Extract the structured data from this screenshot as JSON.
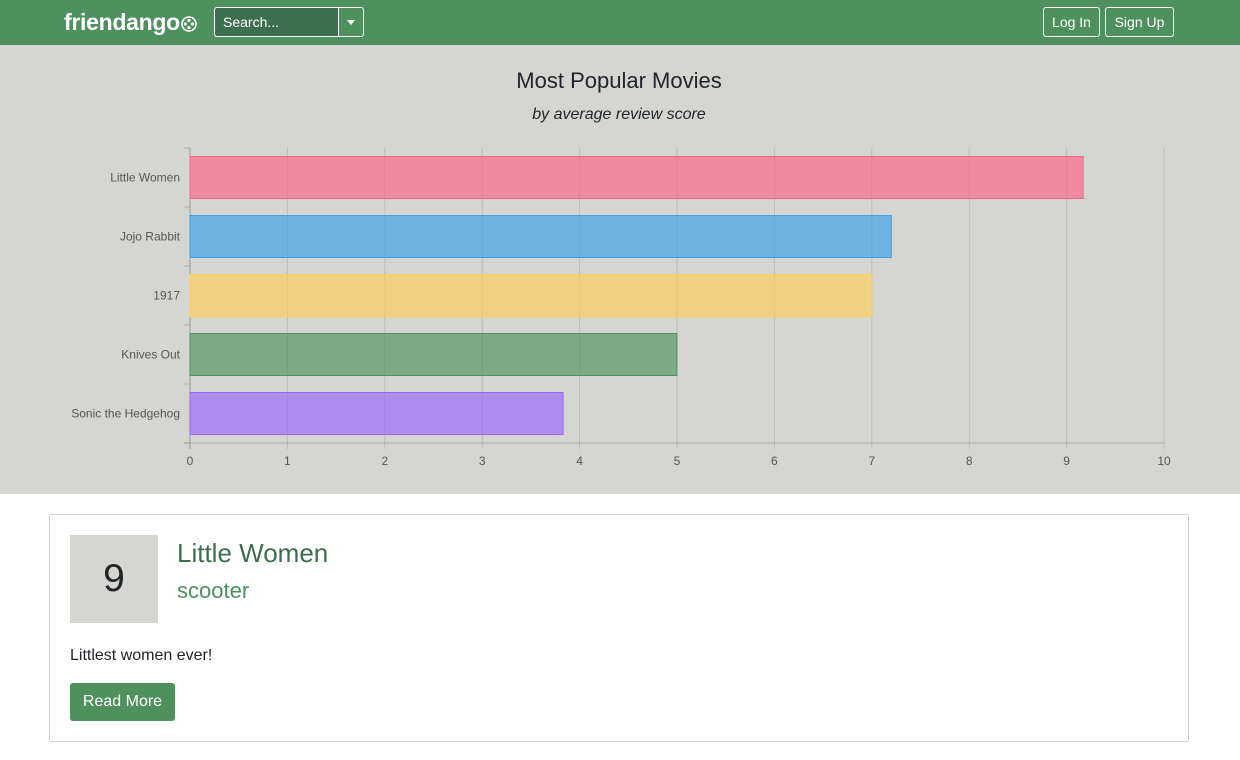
{
  "navbar": {
    "brand_name": "friendango",
    "brand_icon": "film-reel-icon",
    "search": {
      "placeholder": "Search...",
      "value": ""
    },
    "login_label": "Log In",
    "signup_label": "Sign Up"
  },
  "colors": {
    "brand_green": "#4e915f",
    "dark_green": "#3d6f4e",
    "panel_gray": "#d5d6d2"
  },
  "chart_data": {
    "type": "bar",
    "orientation": "horizontal",
    "title": "Most Popular Movies",
    "subtitle": "by average review score",
    "categories": [
      "Little Women",
      "Jojo Rabbit",
      "1917",
      "Knives Out",
      "Sonic the Hedgehog"
    ],
    "values": [
      9.17,
      7.2,
      7.0,
      5.0,
      3.83
    ],
    "xlim": [
      0,
      10
    ],
    "xticks": [
      0,
      1,
      2,
      3,
      4,
      5,
      6,
      7,
      8,
      9,
      10
    ],
    "grid": true,
    "legend": "none",
    "bar_colors": [
      {
        "fill": "rgba(255,99,132,0.65)",
        "stroke": "#ff6384"
      },
      {
        "fill": "rgba(54,162,235,0.65)",
        "stroke": "#36a2eb"
      },
      {
        "fill": "rgba(255,205,86,0.65)",
        "stroke": "#ffcd56"
      },
      {
        "fill": "rgba(78,145,95,0.65)",
        "stroke": "#4e915f"
      },
      {
        "fill": "rgba(153,102,255,0.65)",
        "stroke": "#9966ff"
      }
    ]
  },
  "review": {
    "score": "9",
    "movie_title": "Little Women",
    "username": "scooter",
    "body": "Littlest women ever!",
    "read_more_label": "Read More"
  }
}
